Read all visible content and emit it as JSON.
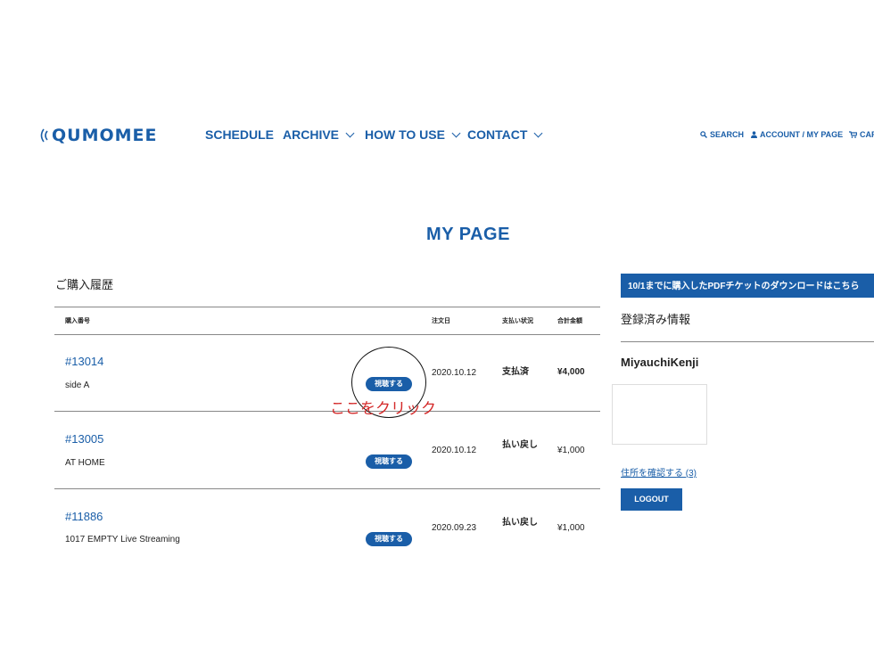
{
  "header": {
    "logo_text": "QUMOMEE",
    "nav": [
      {
        "label": "SCHEDULE",
        "has_dropdown": false
      },
      {
        "label": "ARCHIVE",
        "has_dropdown": true
      },
      {
        "label": "HOW TO USE",
        "has_dropdown": true
      },
      {
        "label": "CONTACT",
        "has_dropdown": true
      }
    ],
    "utility": {
      "search": "SEARCH",
      "account": "ACCOUNT / MY PAGE",
      "cart": "CAR"
    }
  },
  "page_title": "MY PAGE",
  "orders": {
    "section_title": "ご購入履歴",
    "columns": {
      "number": "購入番号",
      "date": "注文日",
      "status": "支払い状況",
      "total": "合計金額"
    },
    "rows": [
      {
        "number": "#13014",
        "name": "side A",
        "button": "視聴する",
        "date": "2020.10.12",
        "status": "支払済",
        "total": "¥4,000"
      },
      {
        "number": "#13005",
        "name": "AT HOME",
        "button": "視聴する",
        "date": "2020.10.12",
        "status": "払い戻し",
        "total": "¥1,000"
      },
      {
        "number": "#11886",
        "name": "1017 EMPTY Live Streaming",
        "button": "視聴する",
        "date": "2020.09.23",
        "status": "払い戻し",
        "total": "¥1,000"
      }
    ]
  },
  "annotation": {
    "text": "ここをクリック",
    "color": "#d42a2a"
  },
  "sidebar": {
    "banner": "10/1までに購入したPDFチケットのダウンロードはこちら",
    "registered_title": "登録済み情報",
    "user_name": "MiyauchiKenji",
    "address_link": "住所を確認する (3)",
    "logout": "LOGOUT"
  },
  "colors": {
    "brand": "#1a5ea8",
    "annotation": "#d42a2a"
  }
}
